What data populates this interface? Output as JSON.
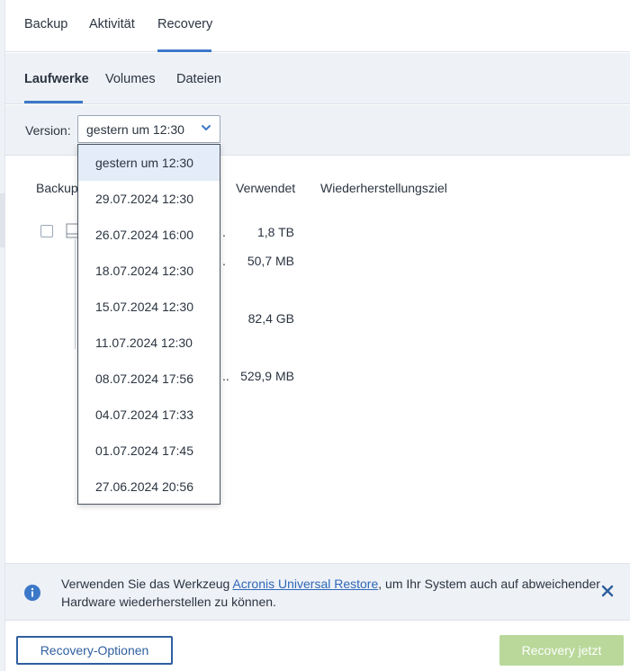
{
  "top_tabs": [
    {
      "label": "Backup"
    },
    {
      "label": "Aktivität"
    },
    {
      "label": "Recovery"
    }
  ],
  "active_top_tab": "Recovery",
  "sub_tabs": [
    {
      "label": "Laufwerke"
    },
    {
      "label": "Volumes"
    },
    {
      "label": "Dateien"
    }
  ],
  "active_sub_tab": "Laufwerke",
  "version": {
    "label": "Version:",
    "selected": "gestern um 12:30",
    "options": [
      "gestern um 12:30",
      "29.07.2024 12:30",
      "26.07.2024 16:00",
      "18.07.2024 12:30",
      "15.07.2024 12:30",
      "11.07.2024 12:30",
      "08.07.2024 17:56",
      "04.07.2024 17:33",
      "01.07.2024 17:45",
      "27.06.2024 20:56"
    ]
  },
  "table": {
    "columns": [
      "Backup",
      "Verwendet",
      "Wiederherstellungsziel"
    ],
    "rows": [
      {
        "trunc": ".",
        "used": "1,8 TB"
      },
      {
        "trunc": ".",
        "used": "50,7 MB"
      },
      {
        "trunc": "",
        "used": "82,4 GB"
      },
      {
        "trunc": "..",
        "used": "529,9 MB"
      }
    ]
  },
  "info": {
    "text_before": "Verwenden Sie das Werkzeug ",
    "link": "Acronis Universal Restore",
    "text_after": ", um Ihr System auch auf abweichender Hardware wiederherstellen zu können."
  },
  "footer": {
    "options_label": "Recovery-Optionen",
    "recover_label": "Recovery jetzt"
  },
  "colors": {
    "accent": "#3c78c8",
    "panel": "#eef1f6",
    "link": "#2f68b8",
    "primary_disabled": "#b9d89a"
  }
}
